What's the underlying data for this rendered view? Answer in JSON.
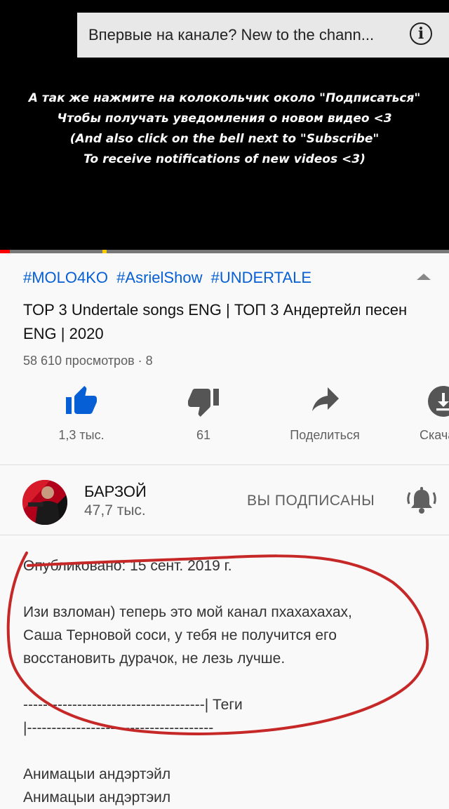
{
  "player": {
    "banner_text": "Впервые на канале? New to the chann...",
    "overlay_lines": [
      "А так же нажмите на колокольчик около \"Подписаться\"",
      "Чтобы получать уведомления о новом видео <3",
      "(And also click on the bell next to \"Subscribe\"",
      "To receive notifications of new videos <3)"
    ],
    "progress_fraction": 0.022
  },
  "video": {
    "tags": [
      "#MOLO4KO",
      "#AsrielShow",
      "#UNDERTALE"
    ],
    "title": "TOP 3 Undertale songs ENG | ТОП 3 Андертейл песен ENG | 2020",
    "views": "58 610 просмотров · 8"
  },
  "actions": [
    {
      "label": "1,3 тыс.",
      "icon": "thumbs-up-icon"
    },
    {
      "label": "61",
      "icon": "thumbs-down-icon"
    },
    {
      "label": "Поделиться",
      "icon": "share-icon"
    },
    {
      "label": "Скача",
      "icon": "download-icon"
    }
  ],
  "channel": {
    "name": "БАРЗОЙ",
    "subscribers": "47,7 тыс.",
    "subscribe_label": "ВЫ ПОДПИСАНЫ",
    "bell_icon": "bell-icon"
  },
  "description": {
    "published": "Опубликовано: 15 сент. 2019 г.",
    "body_lines": [
      "Изи взломан) теперь это мой канал пхахахахах,",
      "Саша Терновой соси, у тебя не получится его",
      "восстановить дурачок, не лезь лучше."
    ],
    "separator1": "-------------------------------------| Теги",
    "separator2": "|--------------------------------------",
    "tags_lines": [
      "Анимацыи андэртэйл",
      "Анимацыи андэртэил"
    ]
  },
  "colors": {
    "link": "#065fd4",
    "accent_like": "#065fd4",
    "annotation": "#c62828",
    "progress": "#ff0000"
  }
}
